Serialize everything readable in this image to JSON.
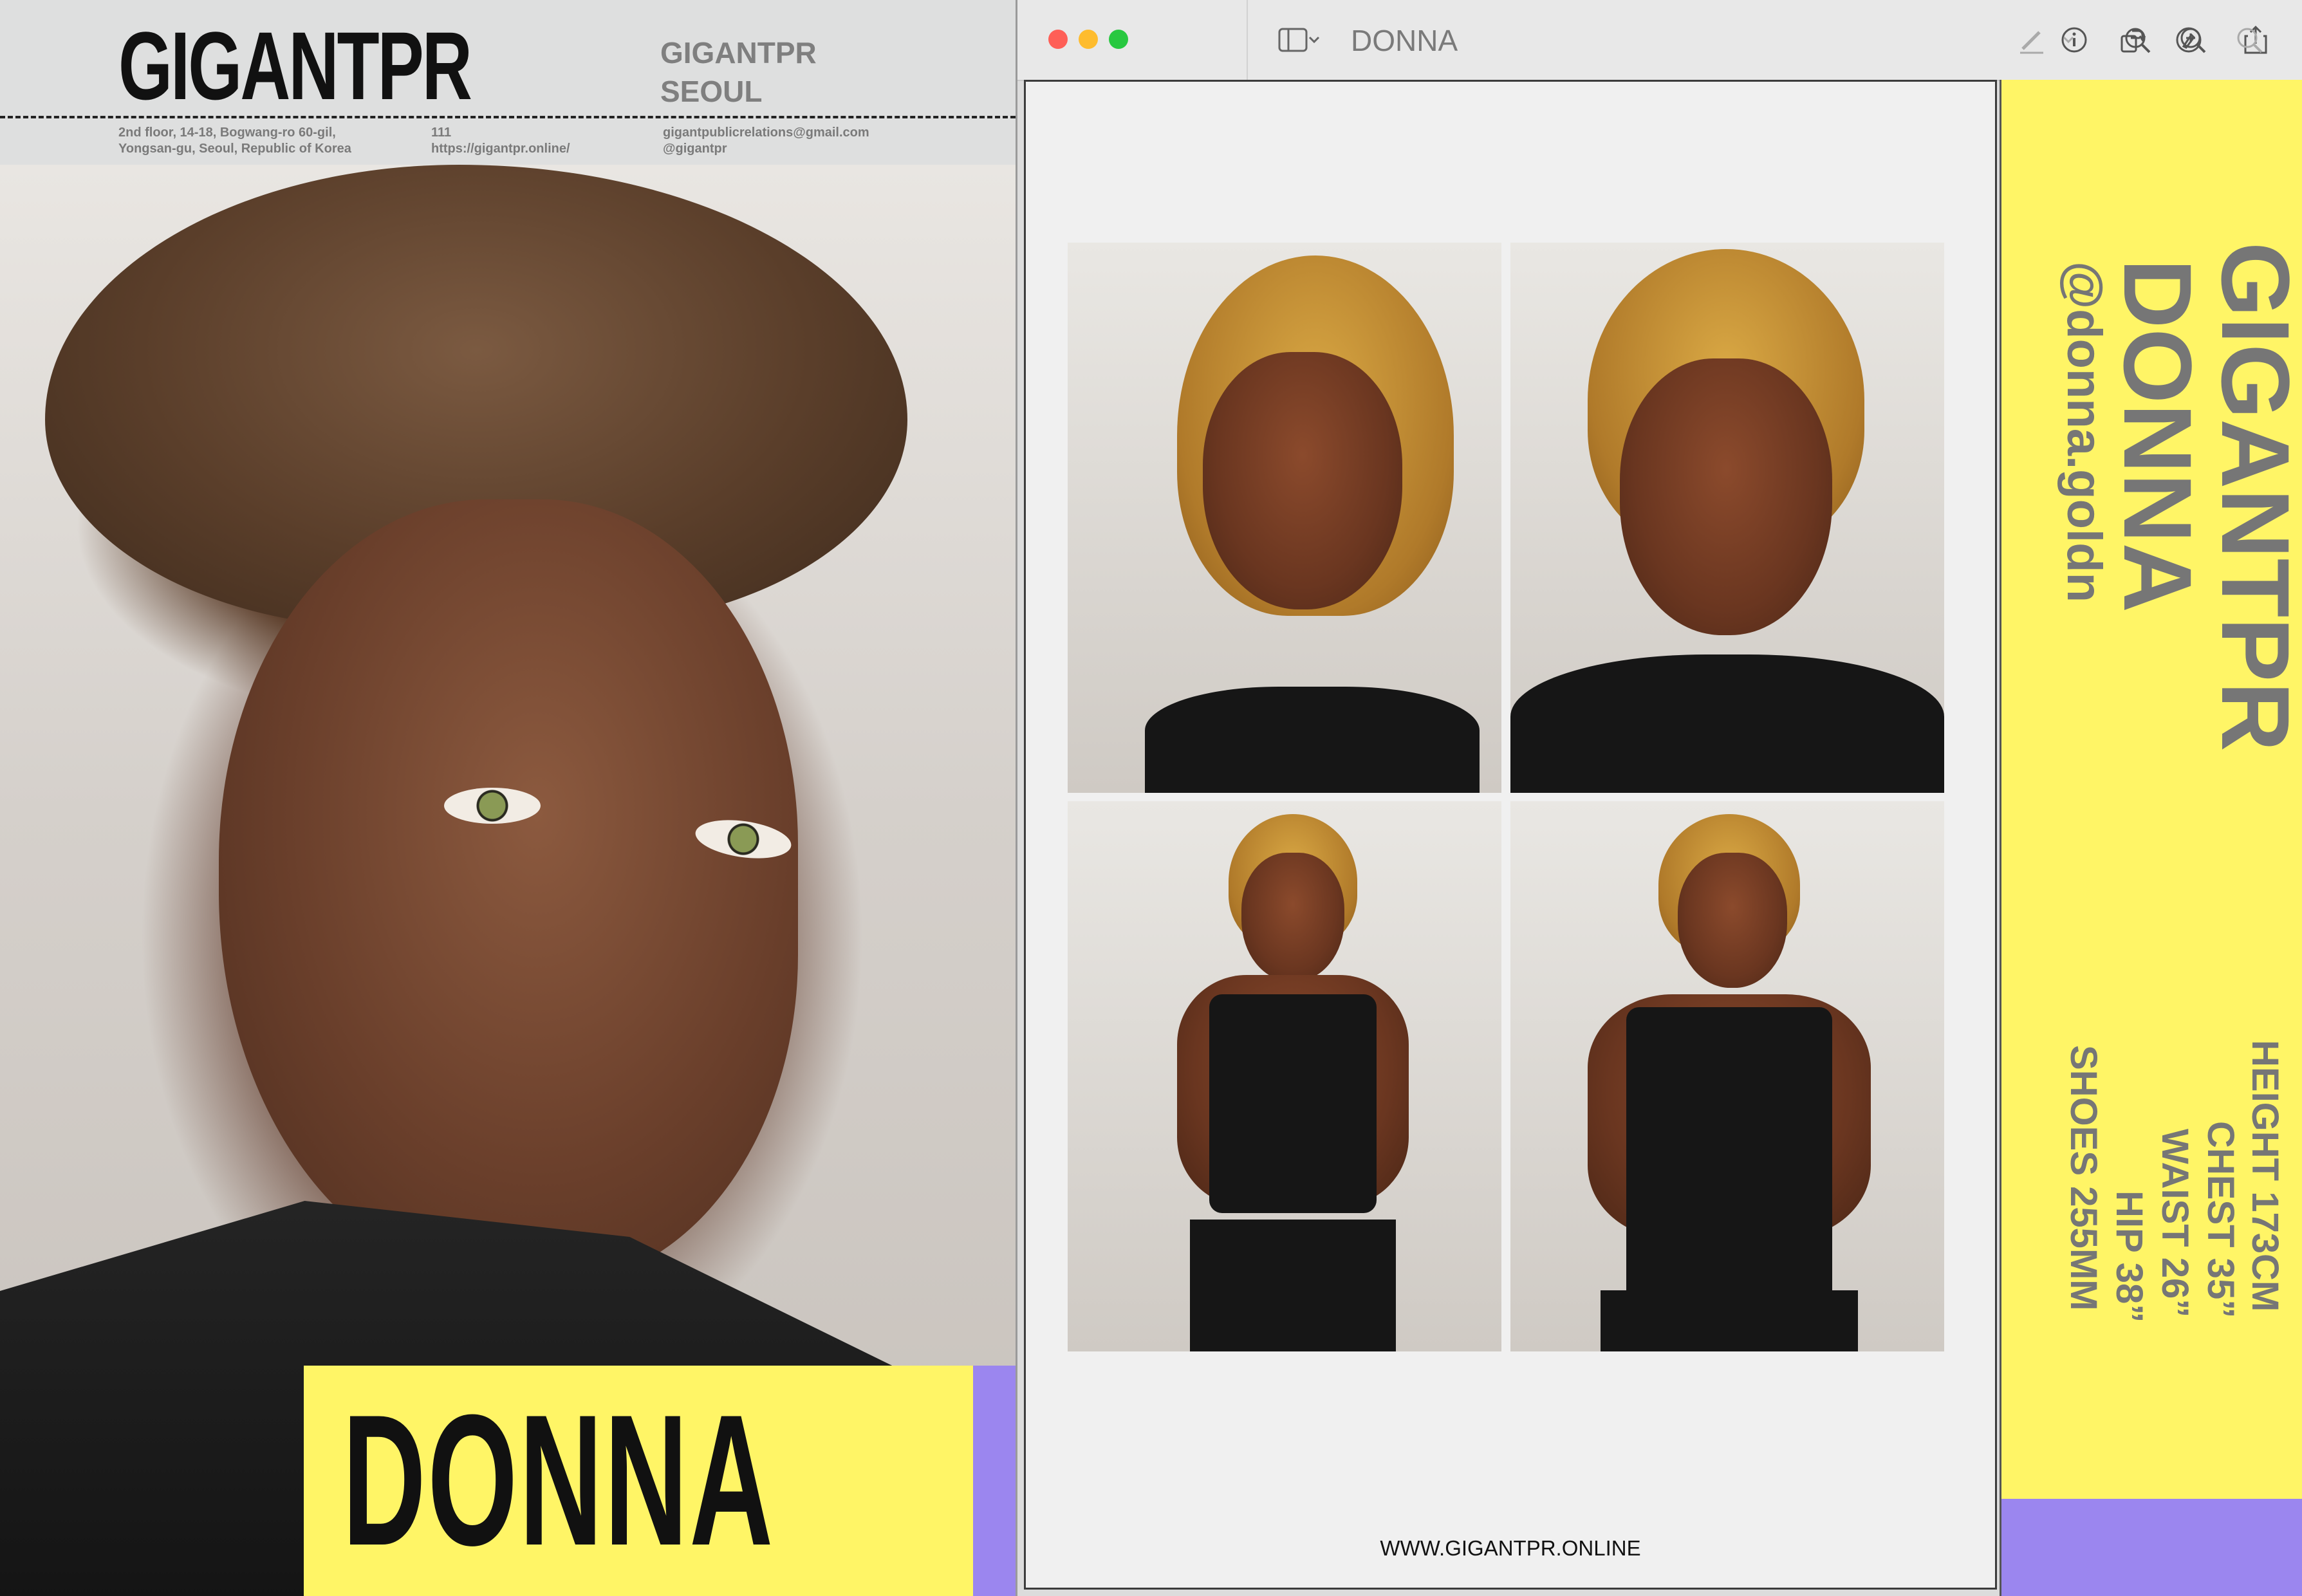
{
  "comp_card": {
    "logo": "GIGANTPR",
    "agency_name": "GIGANTPR",
    "city": "SEOUL",
    "address_line1": "2nd floor, 14-18, Bogwang-ro 60-gil,",
    "address_line2": "Yongsan-gu, Seoul, Republic of Korea",
    "phone": "111",
    "website": "https://gigantpr.online/",
    "email": "gigantpublicrelations@gmail.com",
    "instagram": "@gigantpr",
    "model_name": "DONNA"
  },
  "preview_window": {
    "title": "DONNA",
    "toolbar_icons": [
      "sidebar-icon",
      "chevron-down-icon",
      "info-icon",
      "zoom-out-icon",
      "zoom-in-icon",
      "share-icon",
      "markup-pen-icon",
      "chevron-down-icon",
      "rotate-icon",
      "markup-icon",
      "search-icon"
    ]
  },
  "page_polaroids": {
    "footer_url": "WWW.GIGANTPR.ONLINE"
  },
  "page_stats": {
    "agency": "GIGANTPR",
    "model_name": "DONNA",
    "instagram": "@donna.goldn",
    "height": "HEIGHT 173CM",
    "chest": "CHEST 35”",
    "waist": "WAIST 26”",
    "hip": "HIP 38”",
    "shoes": "SHOES 255MM"
  },
  "colors": {
    "accent_yellow": "#fff566",
    "accent_purple": "#9b86ef",
    "text_gray": "#767676"
  }
}
